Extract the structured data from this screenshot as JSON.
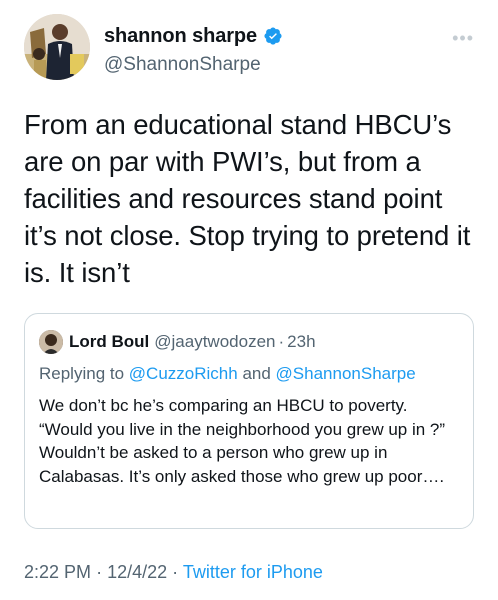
{
  "tweet": {
    "author": {
      "display_name": "shannon sharpe",
      "handle": "@ShannonSharpe",
      "verified": true
    },
    "more_icon": "more-options-icon",
    "text": "From an educational stand HBCU’s are on par with PWI’s, but from a facilities and resources stand point it’s not close. Stop trying to pretend it is. It isn’t",
    "quoted": {
      "display_name": "Lord Boul",
      "handle": "@jaaytwodozen",
      "separator": "·",
      "time_ago": "23h",
      "replying_label": "Replying to",
      "mention_1": "@CuzzoRichh",
      "and_label": "and",
      "mention_2": "@ShannonSharpe",
      "body": "We don’t bc he’s comparing an HBCU to poverty. “Would you live in the neighborhood you grew up in ?” Wouldn’t be asked to a person who grew up in Calabasas. It’s only asked those who grew up poor…."
    },
    "meta": {
      "time": "2:22 PM",
      "date": "12/4/22",
      "separator": "·",
      "source": "Twitter for iPhone"
    },
    "colors": {
      "link": "#1d9bf0",
      "secondary_text": "#536471",
      "border": "#cfd9de"
    }
  }
}
